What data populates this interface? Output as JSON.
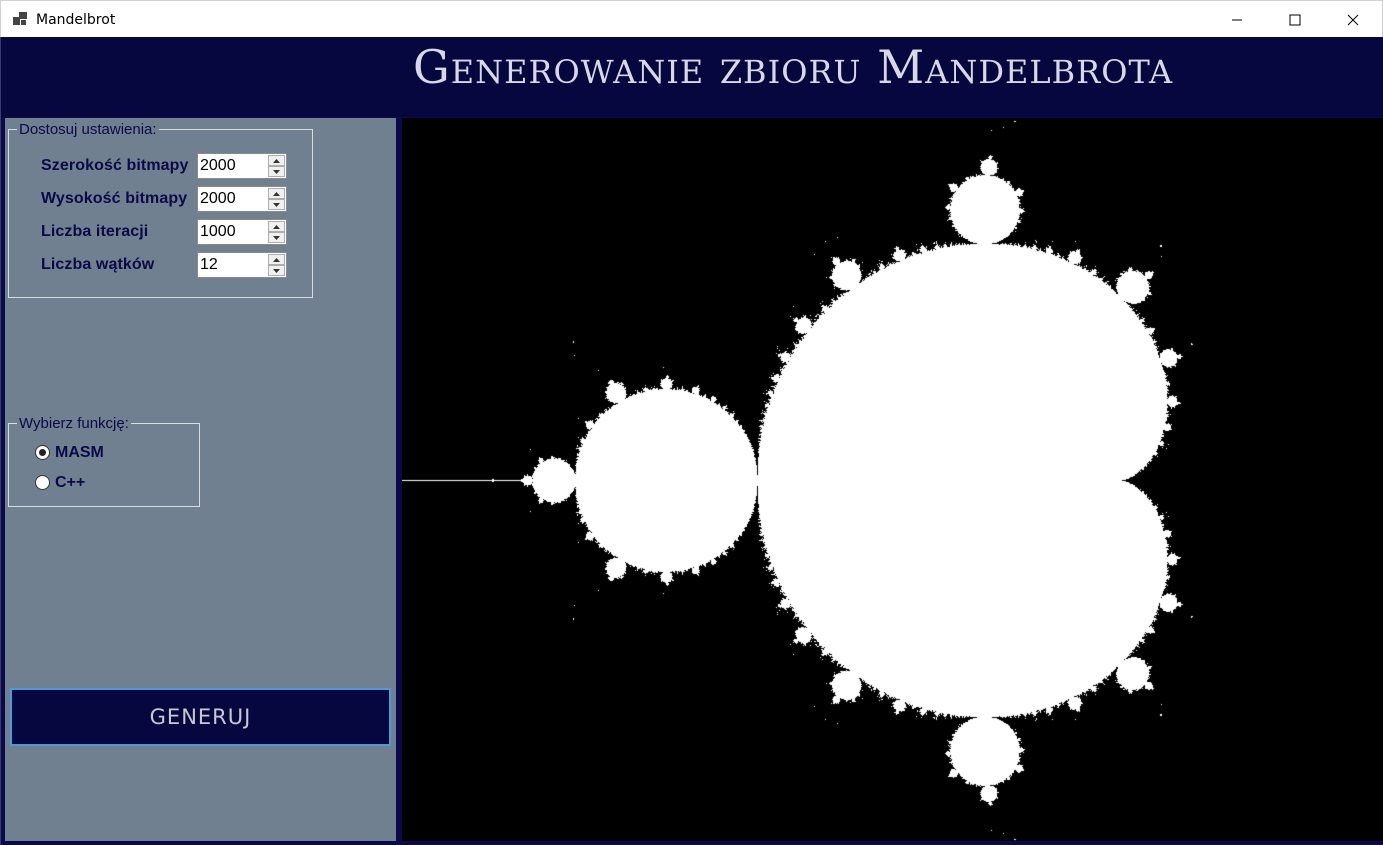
{
  "window": {
    "title": "Mandelbrot",
    "icon": "app-windows-icon",
    "controls": [
      "minimize-icon",
      "maximize-icon",
      "close-icon"
    ]
  },
  "header": {
    "title": "Generowanie zbioru Mandelbrota"
  },
  "settings": {
    "legend": "Dostosuj ustawienia:",
    "fields": [
      {
        "label": "Szerokość bitmapy",
        "value": "2000"
      },
      {
        "label": "Wysokość bitmapy",
        "value": "2000"
      },
      {
        "label": "Liczba iteracji",
        "value": "1000"
      },
      {
        "label": "Liczba wątków",
        "value": "12"
      }
    ]
  },
  "function_select": {
    "legend": "Wybierz funkcję:",
    "options": [
      {
        "label": "MASM",
        "checked": true
      },
      {
        "label": "C++",
        "checked": false
      }
    ]
  },
  "generate_button": {
    "label": "GENERUJ"
  },
  "colors": {
    "header_bg": "#07073f",
    "panel_bg": "#708090",
    "label_text": "#0a0a48",
    "canvas_bg": "#000000",
    "fractal": "#ffffff",
    "button_border": "#4a9bd8"
  }
}
